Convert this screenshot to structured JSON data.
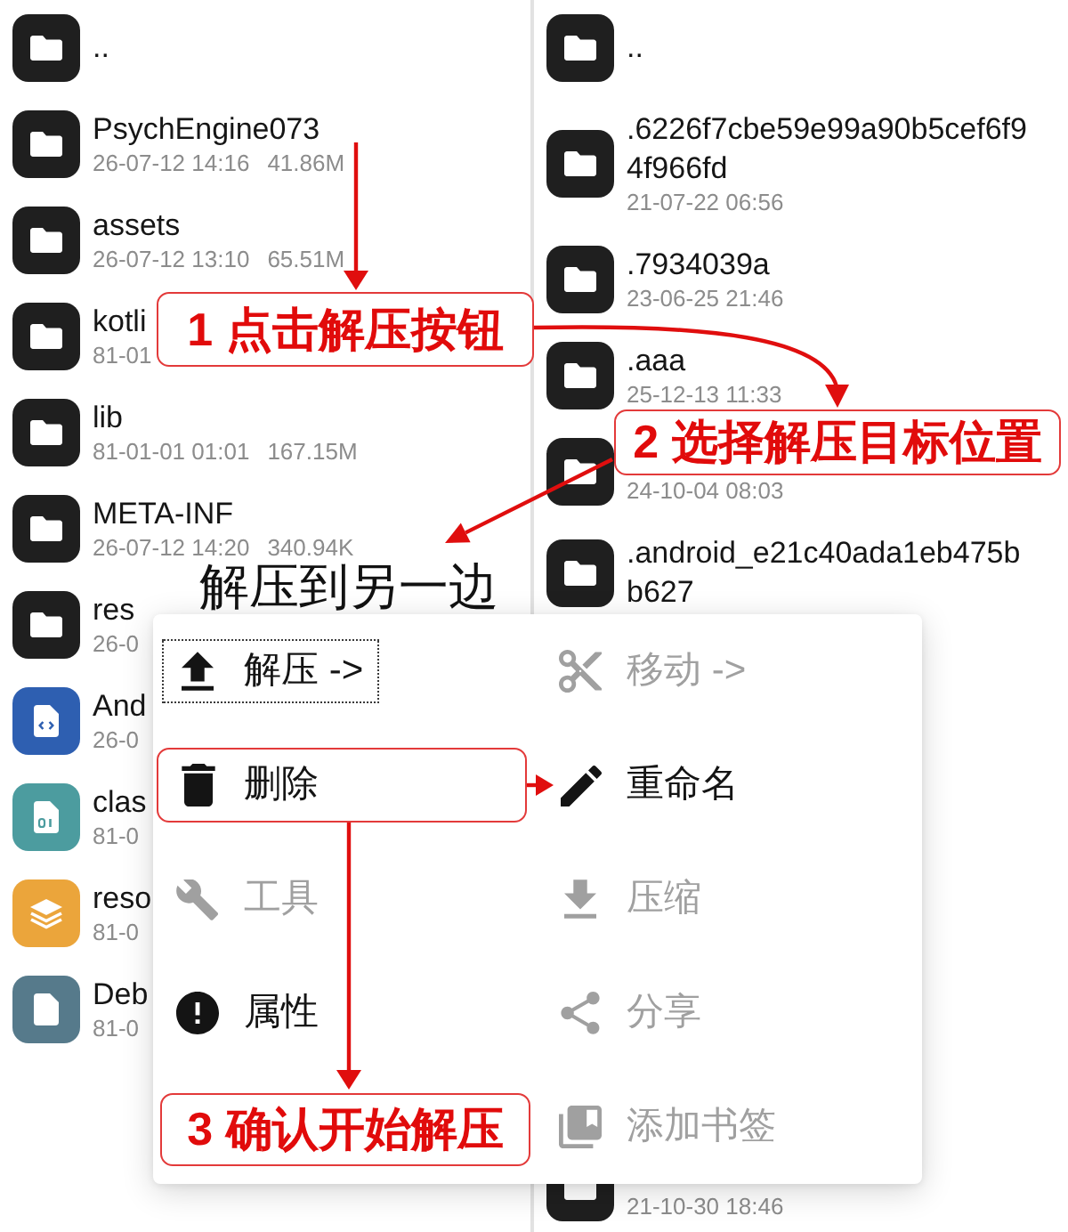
{
  "left_panel": {
    "entries": [
      {
        "kind": "folder",
        "color": "#1f1f1f",
        "name": ".."
      },
      {
        "kind": "folder",
        "color": "#1f1f1f",
        "name": "PsychEngine073",
        "date": "26-07-12 14:16",
        "size": "41.86M"
      },
      {
        "kind": "folder",
        "color": "#1f1f1f",
        "name": "assets",
        "date": "26-07-12 13:10",
        "size": "65.51M"
      },
      {
        "kind": "folder",
        "color": "#1f1f1f",
        "name": "kotli",
        "date": "81-01"
      },
      {
        "kind": "folder",
        "color": "#1f1f1f",
        "name": "lib",
        "date": "81-01-01 01:01",
        "size": "167.15M"
      },
      {
        "kind": "folder",
        "color": "#1f1f1f",
        "name": "META-INF",
        "date": "26-07-12 14:20",
        "size": "340.94K"
      },
      {
        "kind": "folder",
        "color": "#1f1f1f",
        "name": "res",
        "date": "26-0"
      },
      {
        "kind": "markup",
        "color": "#2e5fb1",
        "name": "And",
        "date": "26-0"
      },
      {
        "kind": "binary",
        "color": "#4c9c9f",
        "name": "clas",
        "date": "81-0"
      },
      {
        "kind": "resources",
        "color": "#eba53b",
        "name": "reso",
        "date": "81-0"
      },
      {
        "kind": "document",
        "color": "#567a8b",
        "name": "Deb",
        "date": "81-0"
      }
    ]
  },
  "right_panel": {
    "entries": [
      {
        "kind": "folder",
        "color": "#1f1f1f",
        "name": ".."
      },
      {
        "kind": "folder",
        "color": "#1f1f1f",
        "name": ".6226f7cbe59e99a90b5cef6f94f966fd",
        "date": "21-07-22 06:56"
      },
      {
        "kind": "folder",
        "color": "#1f1f1f",
        "name": ".7934039a",
        "date": "23-06-25 21:46"
      },
      {
        "kind": "folder",
        "color": "#1f1f1f",
        "name": ".aaa",
        "date": "25-12-13 11:33"
      },
      {
        "kind": "folder",
        "color": "#1f1f1f",
        "date": "24-10-04 08:03"
      },
      {
        "kind": "folder",
        "color": "#1f1f1f",
        "name": ".android_e21c40ada1eb475bb627"
      },
      {
        "kind": "folder",
        "color": "#1f1f1f",
        "date": "21-10-30 18:46"
      }
    ]
  },
  "context_menu": {
    "columns": [
      {
        "items": [
          {
            "kind": "extract",
            "label": "解压 ->",
            "disabled": false,
            "focused": true
          },
          {
            "kind": "delete",
            "label": "删除",
            "disabled": false,
            "focused": false
          },
          {
            "kind": "tools",
            "label": "工具",
            "disabled": true,
            "focused": false
          },
          {
            "kind": "properties",
            "label": "属性",
            "disabled": false,
            "focused": false
          }
        ]
      },
      {
        "items": [
          {
            "kind": "move",
            "label": "移动 ->",
            "disabled": true,
            "focused": false
          },
          {
            "kind": "rename",
            "label": "重命名",
            "disabled": false,
            "focused": false
          },
          {
            "kind": "compress",
            "label": "压缩",
            "disabled": true,
            "focused": false
          },
          {
            "kind": "share",
            "label": "分享",
            "disabled": true,
            "focused": false
          },
          {
            "kind": "bookmark",
            "label": "添加书签",
            "disabled": true,
            "focused": false
          }
        ]
      }
    ]
  },
  "annotations": {
    "callouts": [
      {
        "text": "1 点击解压按钮"
      },
      {
        "text": "2 选择解压目标位置"
      },
      {
        "text": "3 确认开始解压"
      }
    ],
    "note": "解压到另一边"
  }
}
